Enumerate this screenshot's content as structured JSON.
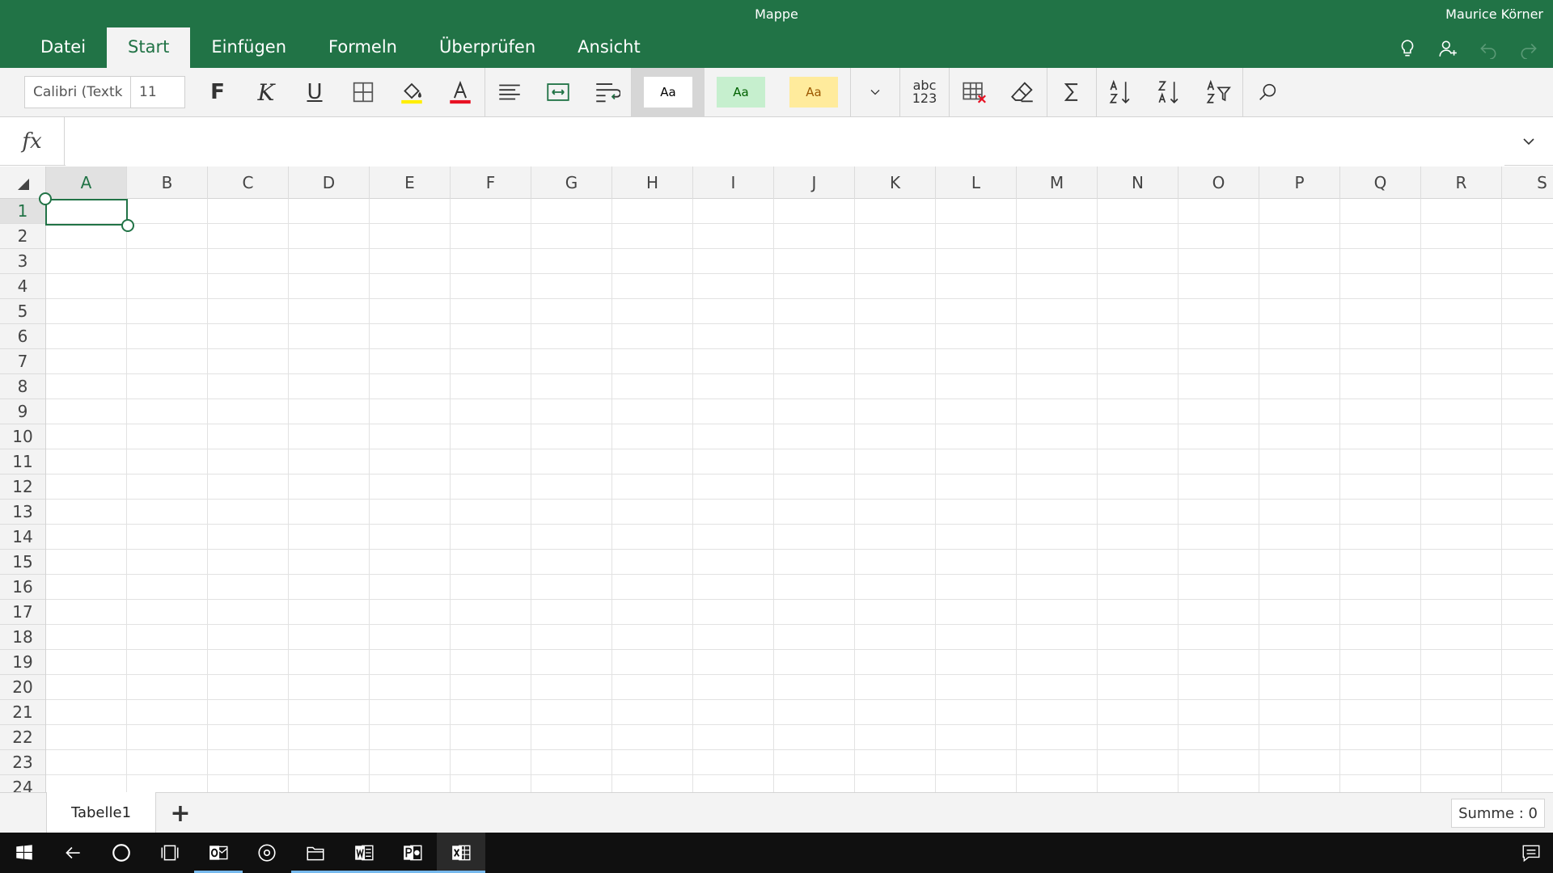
{
  "window": {
    "title": "Mappe",
    "user": "Maurice Körner"
  },
  "ribbon_tabs": [
    {
      "label": "Datei"
    },
    {
      "label": "Start",
      "active": true
    },
    {
      "label": "Einfügen"
    },
    {
      "label": "Formeln"
    },
    {
      "label": "Überprüfen"
    },
    {
      "label": "Ansicht"
    }
  ],
  "ribbon": {
    "font_name": "Calibri (Textk",
    "font_size": "11",
    "bold": "F",
    "italic": "K",
    "underline": "U",
    "styles": [
      {
        "label": "Aa",
        "bg": "#ffffff",
        "fg": "#000000"
      },
      {
        "label": "Aa",
        "bg": "#c6efce",
        "fg": "#006100"
      },
      {
        "label": "Aa",
        "bg": "#ffeb9c",
        "fg": "#9c5700"
      }
    ],
    "number_format_top": "abc",
    "number_format_bottom": "123"
  },
  "formula_bar": {
    "fx": "fx",
    "value": ""
  },
  "grid": {
    "columns": [
      "A",
      "B",
      "C",
      "D",
      "E",
      "F",
      "G",
      "H",
      "I",
      "J",
      "K",
      "L",
      "M",
      "N",
      "O",
      "P",
      "Q",
      "R",
      "S"
    ],
    "rows": [
      "1",
      "2",
      "3",
      "4",
      "5",
      "6",
      "7",
      "8",
      "9",
      "10",
      "11",
      "12",
      "13",
      "14",
      "15",
      "16",
      "17",
      "18",
      "19",
      "20",
      "21",
      "22",
      "23",
      "24"
    ],
    "selected_cell": "A1"
  },
  "sheets": [
    {
      "name": "Tabelle1",
      "active": true
    }
  ],
  "status": {
    "sum": "Summe : 0"
  },
  "colors": {
    "accent": "#217346",
    "ribbon_bg": "#f3f3f3",
    "taskbar": "#101010"
  }
}
